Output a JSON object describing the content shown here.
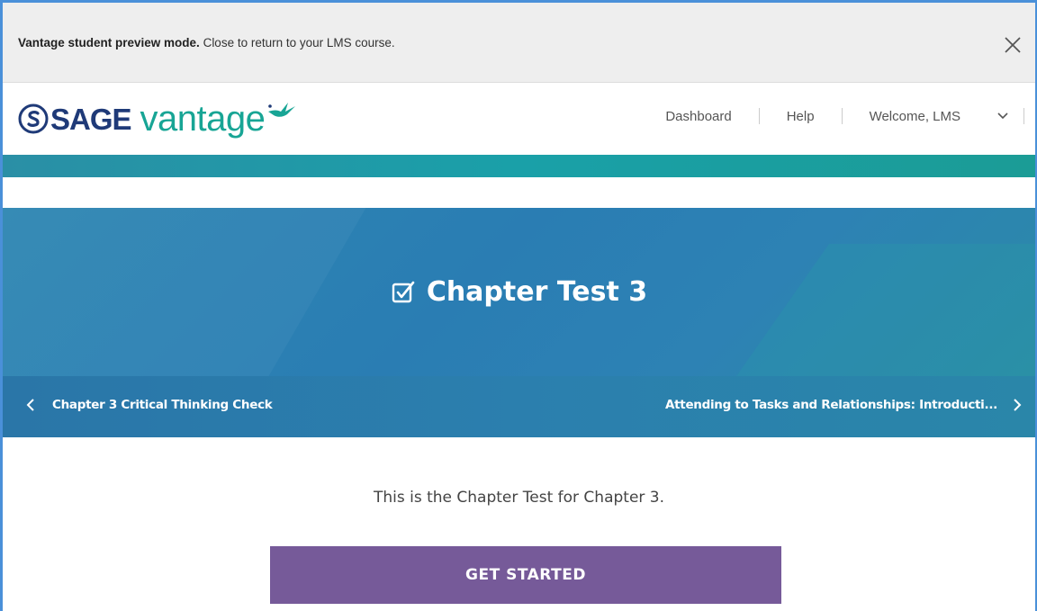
{
  "preview_banner": {
    "bold_text": "Vantage student preview mode.",
    "text": " Close to return to your LMS course."
  },
  "logo": {
    "brand": "SAGE",
    "product": "vantage"
  },
  "nav": {
    "dashboard": "Dashboard",
    "help": "Help",
    "welcome": "Welcome, LMS"
  },
  "hero": {
    "title": "Chapter Test 3",
    "prev": "Chapter 3 Critical Thinking Check",
    "next": "Attending to Tasks and Relationships: Introducti..."
  },
  "content": {
    "intro": "This is the Chapter Test for Chapter 3.",
    "button": "GET STARTED"
  },
  "colors": {
    "accent_teal": "#18a595",
    "brand_navy": "#1f3a78",
    "hero_blue": "#2a7db3",
    "button_purple": "#765a99"
  },
  "icons": [
    "close-icon",
    "sage-logo-icon",
    "hummingbird-icon",
    "chevron-down-icon",
    "checkbox-icon",
    "chevron-left-icon",
    "chevron-right-icon"
  ]
}
